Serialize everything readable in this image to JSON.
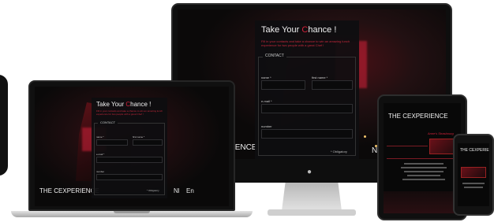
{
  "form": {
    "title_pre": "Take Your ",
    "title_hl": "C",
    "title_post": "hance !",
    "intro": "Fill in your contacts and take a chance to win an amazing lunch experience for two people with a great Chef !",
    "legend": "CONTACT",
    "fields": {
      "name": "name *",
      "first_name": "first name *",
      "email": "e-mail *",
      "number": "number"
    },
    "obligatory": "* Obligatory"
  },
  "brand": {
    "the": "THE ",
    "c": "C",
    "rest": "EXPERIENCE"
  },
  "languages": [
    "Nl",
    "En"
  ],
  "ipad": {
    "subtitle": "Anne's Strasbourg"
  },
  "icons": [
    "apple-logo-icon"
  ],
  "colors": {
    "accent": "#d3213a",
    "panel_bg": "#0e0e10",
    "page_bg": "#ffffff"
  }
}
